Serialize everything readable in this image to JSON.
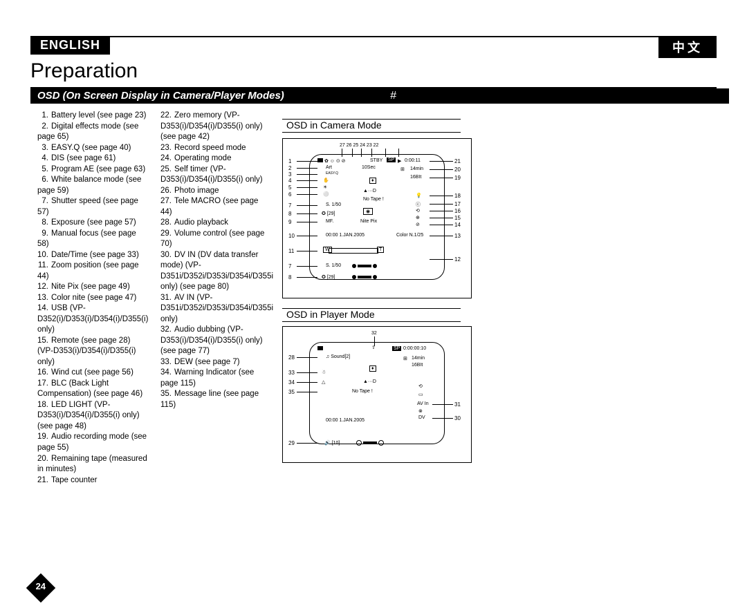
{
  "lang_en": "ENGLISH",
  "lang_cn": "中文",
  "title": "Preparation",
  "section_left": "OSD (On Screen Display in Camera/Player Modes)",
  "section_right": "#",
  "page_number": "24",
  "items": [
    "Battery level (see page 23)",
    "Digital effects mode (see page 65)",
    "EASY.Q (see page 40)",
    "DIS (see page 61)",
    "Program AE (see page 63)",
    "White balance mode (see page 59)",
    "Shutter speed (see page 57)",
    "Exposure (see page 57)",
    "Manual focus (see page 58)",
    "Date/Time (see page 33)",
    "Zoom position (see page 44)",
    "Nite Pix (see page 49)",
    "Color nite (see page 47)",
    "USB (VP-D352(i)/D353(i)/D354(i)/D355(i) only)",
    "Remote (see page 28) (VP-D353(i)/D354(i)/D355(i) only)",
    "Wind cut (see page 56)",
    "BLC (Back Light Compensation) (see page 46)",
    "LED LIGHT (VP-D353(i)/D354(i)/D355(i) only) (see page 48)",
    "Audio recording mode (see page 55)",
    "Remaining tape (measured in minutes)",
    "Tape counter",
    "Zero memory (VP-D353(i)/D354(i)/D355(i) only) (see page 42)",
    "Record speed mode",
    "Operating mode",
    "Self timer (VP-D353(i)/D354(i)/D355(i) only)",
    "Photo image",
    "Tele MACRO (see page 44)",
    "Audio playback",
    "Volume control (see page 70)",
    "DV IN (DV data transfer mode) (VP-D351i/D352i/D353i/D354i/D355i only) (see page 80)",
    "AV IN (VP-D351i/D352i/D353i/D354i/D355i only)",
    "Audio dubbing (VP-D353(i)/D354(i)/D355(i) only) (see page 77)",
    "DEW (see page 7)",
    "Warning Indicator (see page 115)",
    "Message line (see page 115)"
  ],
  "osd_head1": "OSD in Camera Mode",
  "osd_head2": "OSD in Player Mode",
  "d1": {
    "top_nums": "27  26 25  24   23  22",
    "stby": "STBY",
    "sp": "SP",
    "time": "0:00:11",
    "art": "Art",
    "sec": "10Sec",
    "min": "14min",
    "bit": "16BIt",
    "easyq": "EASY.Q",
    "eject": "▲···D",
    "notape": "No Tape !",
    "shutter": "S. 1/50",
    "exp": "[29]",
    "mf": "MF.",
    "nite": "Nite Pix",
    "date": "00:00  1.JAN.2005",
    "color": "Color N.1/25",
    "zoomW": "W",
    "zoomT": "T",
    "left": [
      "1",
      "2",
      "3",
      "4",
      "5",
      "6",
      "7",
      "8",
      "9",
      "10",
      "11",
      "7",
      "8"
    ],
    "right": [
      "21",
      "20",
      "19",
      "18",
      "17",
      "16",
      "15",
      "14",
      "13",
      "12"
    ]
  },
  "d2": {
    "topnum": "32",
    "sound": "Sound[2]",
    "sp": "SP",
    "time": "0:00:00:10",
    "min": "14min",
    "bit": "16BIt",
    "eject": "▲···D",
    "notape": "No Tape !",
    "avin": "AV In",
    "dv": "DV",
    "date": "00:00  1.JAN.2005",
    "vol": "[10]",
    "left": [
      "28",
      "33",
      "34",
      "35",
      "29"
    ],
    "right": [
      "31",
      "30"
    ]
  }
}
